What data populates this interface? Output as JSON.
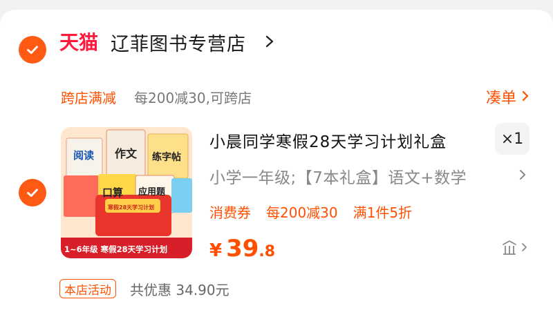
{
  "store": {
    "brand": "天猫",
    "name": "辽菲图书专营店"
  },
  "promo": {
    "tag": "跨店满减",
    "text": "每200减30,可跨店",
    "link": "凑单"
  },
  "product": {
    "title": "小晨同学寒假28天学习计划礼盒",
    "quantity": "×1",
    "sku": "小学一年级;【7本礼盒】语文+数学",
    "coupons": [
      "消费券",
      "每200减30",
      "满1件5折"
    ],
    "price_symbol": "¥",
    "price_int": "39",
    "price_dec": ".8",
    "image": {
      "books": [
        "阅读",
        "作文",
        "练字帖",
        "口算",
        "应用题"
      ],
      "banner": "1~6年级 寒假28天学习计划",
      "box_title": "寒假28天学习计划"
    }
  },
  "activity": {
    "tag": "本店活动",
    "text": "共优惠 34.90元"
  },
  "colors": {
    "accent": "#ff5000",
    "tmall": "#ff1a3c",
    "check": "#ff5a14"
  }
}
